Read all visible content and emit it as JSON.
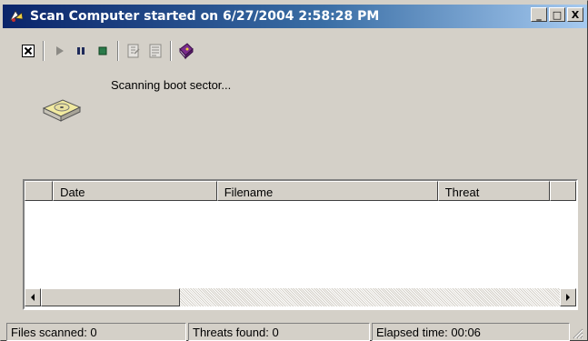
{
  "window": {
    "title": "Scan Computer started on 6/27/2004 2:58:28 PM",
    "app_icon": "scan-app-icon",
    "minimize_label": "_",
    "maximize_label": "□",
    "close_label": "X"
  },
  "toolbar": {
    "buttons": [
      {
        "name": "close-scan-icon",
        "enabled": true
      },
      {
        "name": "play-icon",
        "enabled": false
      },
      {
        "name": "pause-icon",
        "enabled": true
      },
      {
        "name": "stop-icon",
        "enabled": true
      },
      {
        "name": "properties-icon",
        "enabled": false
      },
      {
        "name": "report-icon",
        "enabled": false
      },
      {
        "name": "help-book-icon",
        "enabled": true
      }
    ]
  },
  "status_message": "Scanning boot sector...",
  "scan_icon": "disk-drive-icon",
  "results_table": {
    "columns": [
      "",
      "Date",
      "Filename",
      "Threat",
      ""
    ],
    "rows": []
  },
  "status_bar": {
    "files_scanned": "Files scanned: 0",
    "threats_found": "Threats found: 0",
    "elapsed_time": "Elapsed time: 00:06"
  },
  "colors": {
    "title_start": "#0a246a",
    "title_end": "#a6caf0",
    "face": "#d4d0c8"
  }
}
